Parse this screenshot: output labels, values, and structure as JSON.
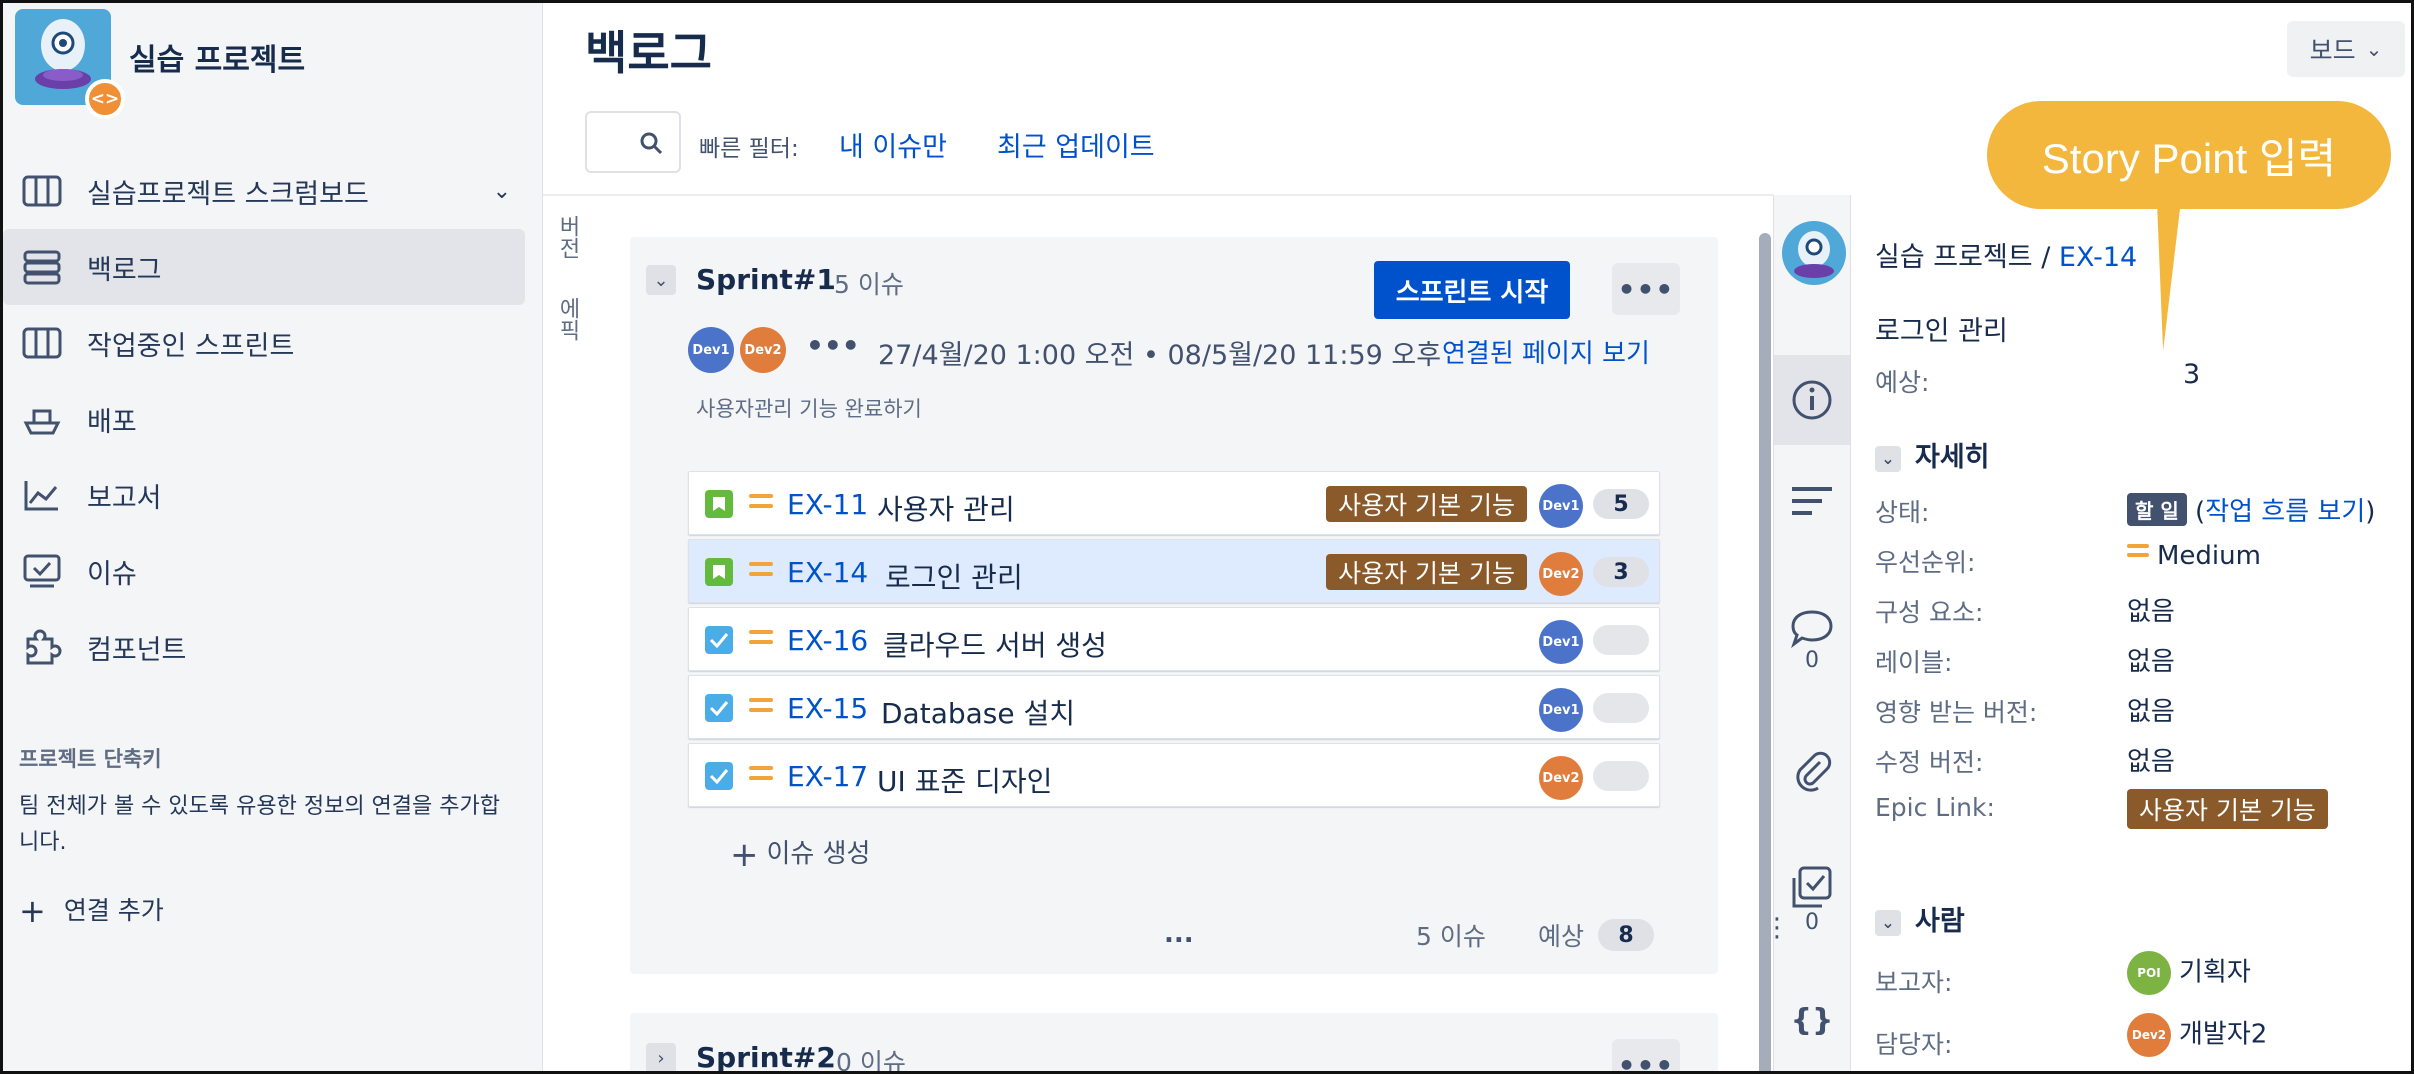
{
  "sidebar": {
    "project_name": "실습 프로젝트",
    "badge_glyph": "<>",
    "nav": [
      {
        "label": "실습프로젝트 스크럼보드",
        "icon": "board-icon",
        "active": false
      },
      {
        "label": "백로그",
        "icon": "backlog-icon",
        "active": true
      },
      {
        "label": "작업중인 스프린트",
        "icon": "columns-icon",
        "active": false
      },
      {
        "label": "배포",
        "icon": "ship-icon",
        "active": false
      },
      {
        "label": "보고서",
        "icon": "chart-icon",
        "active": false
      },
      {
        "label": "이슈",
        "icon": "issues-icon",
        "active": false
      },
      {
        "label": "컴포넌트",
        "icon": "puzzle-icon",
        "active": false
      }
    ],
    "shortcut_title": "프로젝트 단축키",
    "shortcut_desc": "팀 전체가 볼 수 있도록 유용한 정보의 연결을 추가합니다.",
    "add_link": "연결 추가"
  },
  "header": {
    "title": "백로그",
    "board_button": "보드",
    "quick_filter_label": "빠른 필터:",
    "filters": [
      "내 이슈만",
      "최근 업데이트"
    ]
  },
  "vertical_tabs": [
    "버전",
    "에픽"
  ],
  "sprint1": {
    "name": "Sprint#1",
    "count": "5 이슈",
    "start_button": "스프린트 시작",
    "dates": "27/4월/20 1:00 오전  •  08/5월/20 11:59 오후",
    "linked_page": "연결된 페이지 보기",
    "goal": "사용자관리 기능 완료하기",
    "members": [
      "Dev1",
      "Dev2"
    ],
    "issues": [
      {
        "type": "story",
        "key": "EX-11",
        "summary": "사용자 관리",
        "epic": "사용자 기본 기능",
        "assignee": "Dev1",
        "points": "5"
      },
      {
        "type": "story",
        "key": "EX-14",
        "summary": "로그인 관리",
        "epic": "사용자 기본 기능",
        "assignee": "Dev2",
        "points": "3"
      },
      {
        "type": "task",
        "key": "EX-16",
        "summary": "클라우드 서버 생성",
        "epic": "",
        "assignee": "Dev1",
        "points": ""
      },
      {
        "type": "task",
        "key": "EX-15",
        "summary": "Database 설치",
        "epic": "",
        "assignee": "Dev1",
        "points": ""
      },
      {
        "type": "task",
        "key": "EX-17",
        "summary": "UI 표준 디자인",
        "epic": "",
        "assignee": "Dev2",
        "points": ""
      }
    ],
    "create_issue": "이슈 생성",
    "footer_count": "5 이슈",
    "footer_estimate_label": "예상",
    "footer_points": "8"
  },
  "sprint2": {
    "name": "Sprint#2",
    "count": "0 이슈"
  },
  "detail": {
    "project": "실습 프로젝트",
    "separator": "/",
    "key": "EX-14",
    "title": "로그인 관리",
    "estimate_label": "예상:",
    "estimate_value": "3",
    "details_heading": "자세히",
    "fields": {
      "status_label": "상태:",
      "status_value": "할 일",
      "workflow_link": "작업 흐름 보기",
      "priority_label": "우선순위:",
      "priority_value": "Medium",
      "component_label": "구성 요소:",
      "component_value": "없음",
      "label_label": "레이블:",
      "label_value": "없음",
      "affects_label": "영향 받는 버전:",
      "affects_value": "없음",
      "fix_label": "수정 버전:",
      "fix_value": "없음",
      "epic_label": "Epic Link:",
      "epic_value": "사용자 기본 기능"
    },
    "people_heading": "사람",
    "reporter_label": "보고자:",
    "reporter_avatar": "POI",
    "reporter_name": "기획자",
    "assignee_label": "담당자:",
    "assignee_avatar": "Dev2",
    "assignee_name": "개발자2",
    "comments_count": "0",
    "checklist_count": "0"
  },
  "callout": "Story Point 입력",
  "colors": {
    "accent": "#0052cc",
    "epic": "#8b5a2b",
    "callout": "#f3b73d",
    "story": "#63ba3c",
    "task": "#4bade8",
    "priority": "#f2a33a"
  }
}
